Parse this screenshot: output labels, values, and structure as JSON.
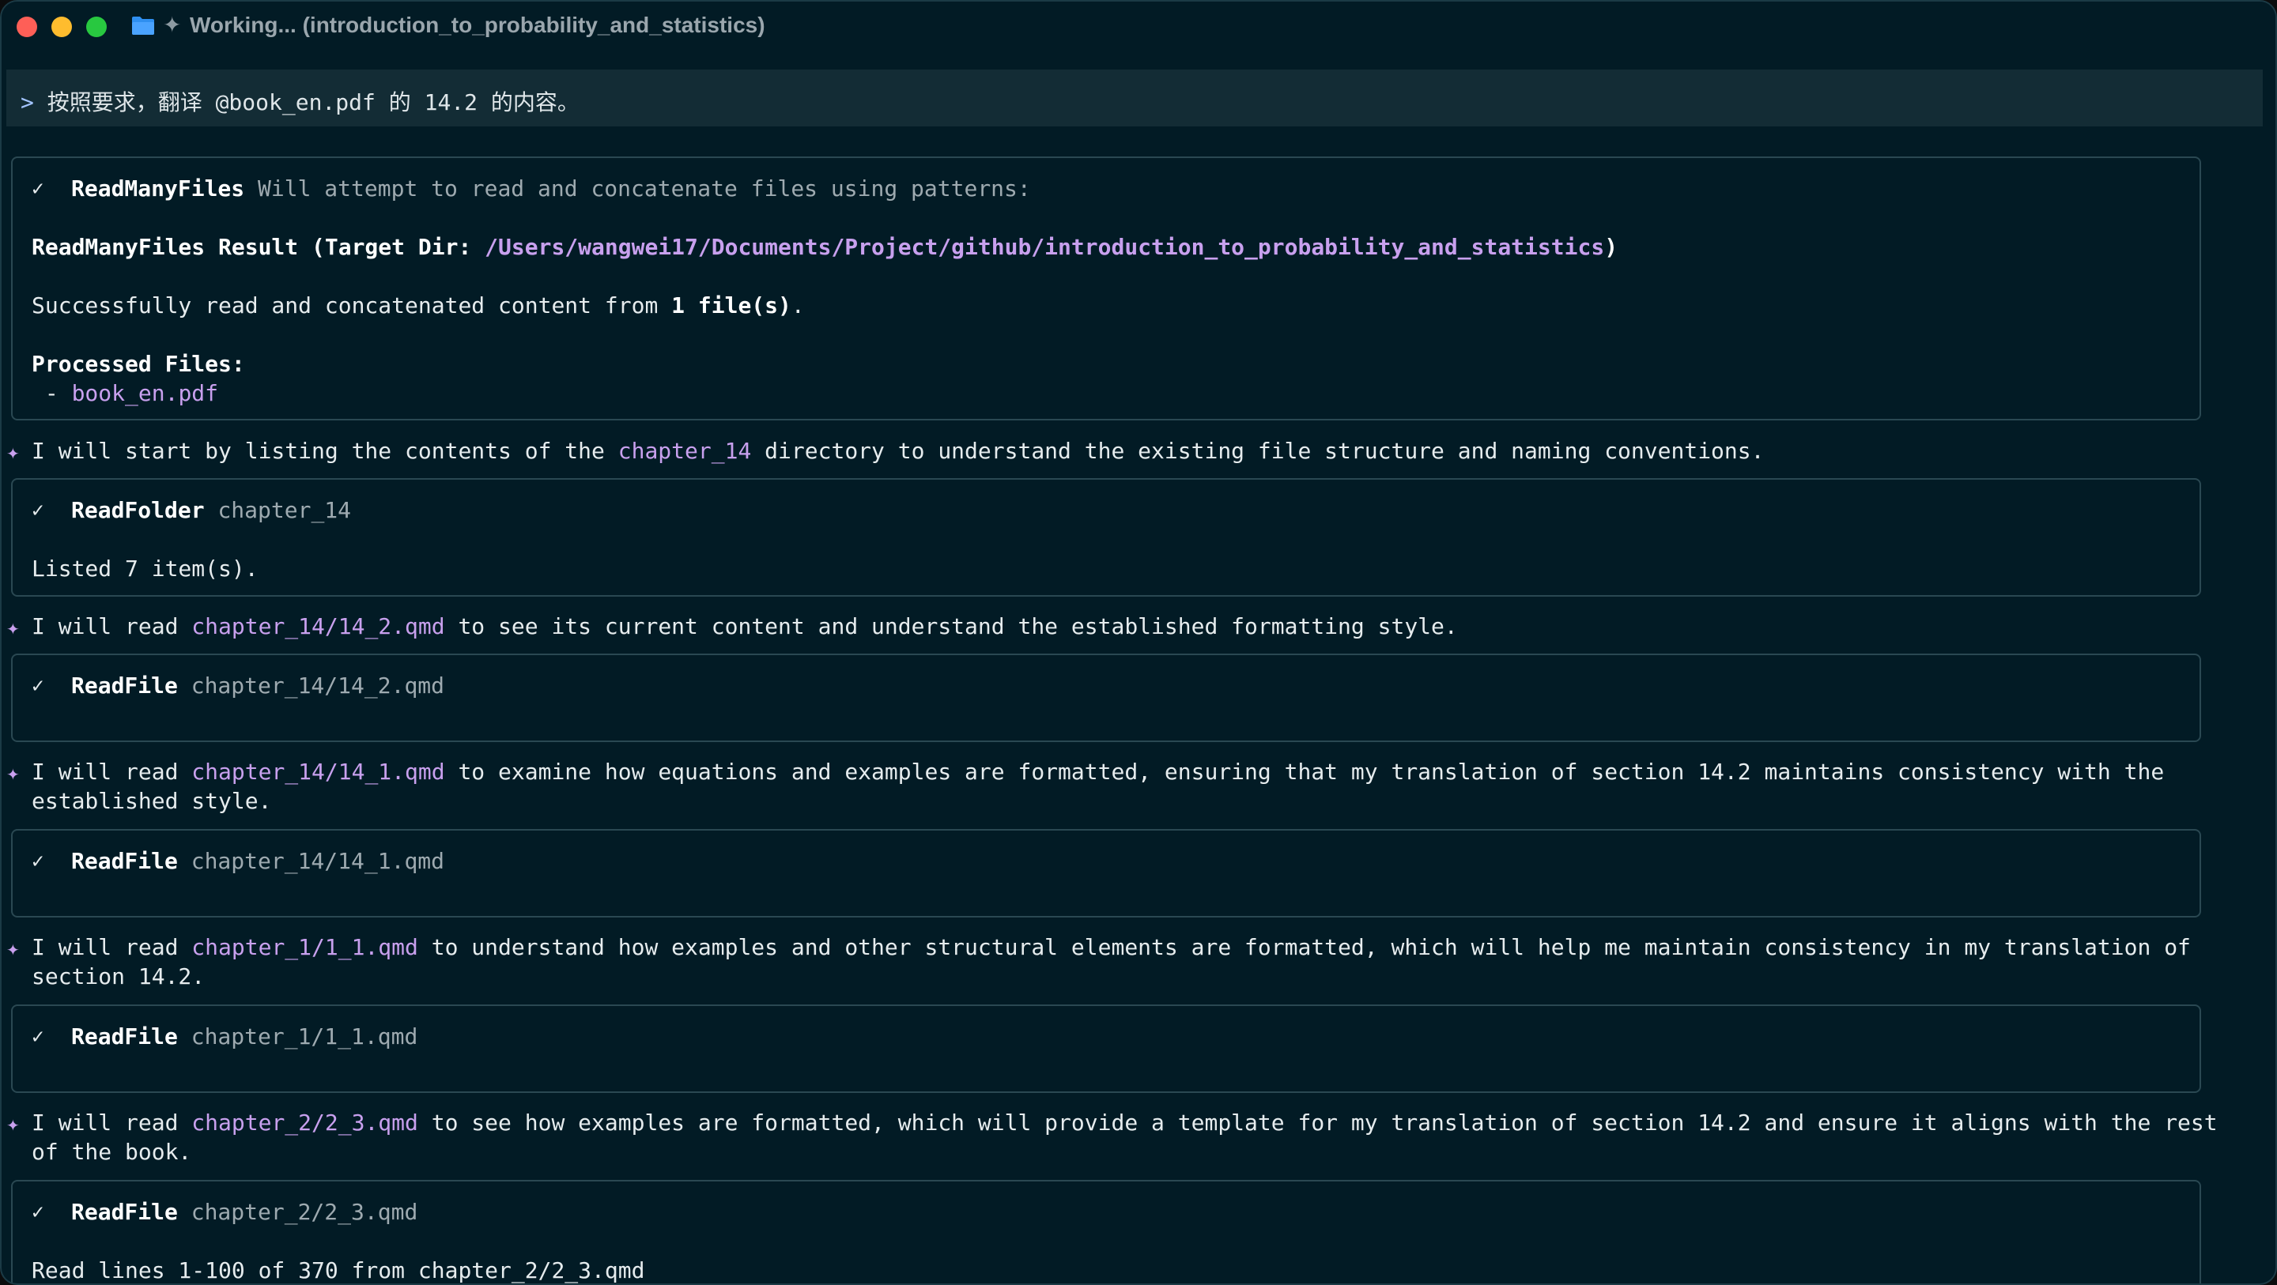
{
  "window": {
    "title": "Working... (introduction_to_probability_and_statistics)"
  },
  "prompt": {
    "caret": ">",
    "text": "按照要求，翻译 @book_en.pdf 的 14.2 的内容。"
  },
  "tool_calls": [
    {
      "tool": "ReadManyFiles",
      "desc": "Will attempt to read and concatenate files using patterns:",
      "result_label": "ReadManyFiles Result (Target Dir: ",
      "result_path": "/Users/wangwei17/Documents/Project/github/introduction_to_probability_and_statistics",
      "result_close": ")",
      "success_prefix": "Successfully read and concatenated content from ",
      "success_count": "1 file(s)",
      "success_suffix": ".",
      "processed_label": "Processed Files:",
      "processed_bullet": " - ",
      "processed_file": "book_en.pdf"
    },
    {
      "tool": "ReadFolder",
      "desc": "chapter_14",
      "result": "Listed 7 item(s)."
    },
    {
      "tool": "ReadFile",
      "desc": "chapter_14/14_2.qmd"
    },
    {
      "tool": "ReadFile",
      "desc": "chapter_14/14_1.qmd"
    },
    {
      "tool": "ReadFile",
      "desc": "chapter_1/1_1.qmd"
    },
    {
      "tool": "ReadFile",
      "desc": "chapter_2/2_3.qmd",
      "result": "Read lines 1-100 of 370 from chapter_2/2_3.qmd"
    }
  ],
  "messages": [
    {
      "pre": "I will start by listing the contents of the ",
      "link": "chapter_14",
      "post": " directory to understand the existing file structure and naming conventions."
    },
    {
      "pre": "I will read ",
      "link": "chapter_14/14_2.qmd",
      "post": " to see its current content and understand the established formatting style."
    },
    {
      "pre": "I will read ",
      "link": "chapter_14/14_1.qmd",
      "post": " to examine how equations and examples are formatted, ensuring that my translation of section 14.2 maintains consistency with the",
      "cont": "established style."
    },
    {
      "pre": "I will read ",
      "link": "chapter_1/1_1.qmd",
      "post": " to understand how examples and other structural elements are formatted, which will help me maintain consistency in my translation of",
      "cont": "section 14.2."
    },
    {
      "pre": "I will read ",
      "link": "chapter_2/2_3.qmd",
      "post": " to see how examples are formatted, which will provide a template for my translation of section 14.2 and ensure it aligns with the rest",
      "cont": "of the book."
    }
  ],
  "check_glyph": "✓",
  "star_glyph": "✦",
  "icons": {
    "folder": "folder-icon",
    "sparkle": "sparkle-icon"
  },
  "colors": {
    "background": "#021b25",
    "accent": "#c8a0ee",
    "prompt_bar": "#132c35"
  }
}
